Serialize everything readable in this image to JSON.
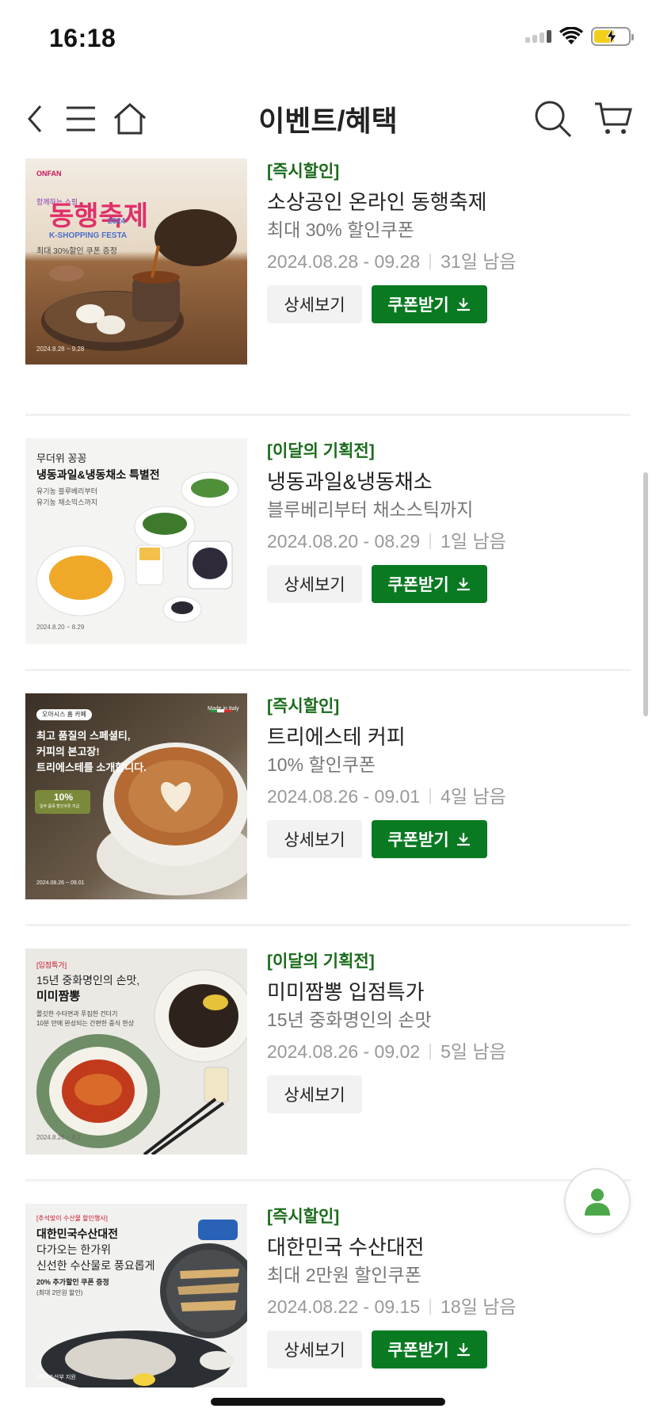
{
  "status_bar": {
    "time": "16:18"
  },
  "header": {
    "title": "이벤트/혜택"
  },
  "events": [
    {
      "category": "[즉시할인]",
      "title": "소상공인 온라인 동행축제",
      "subtitle": "최대 30% 할인쿠폰",
      "dates": "2024.08.28 - 09.28",
      "remaining": "31일 남음",
      "detail_label": "상세보기",
      "coupon_label": "쿠폰받기",
      "thumb": {
        "logo": "ONFAN",
        "line1": "함께하는 쇼핑",
        "headline": "동행축제",
        "year": "2024",
        "tagline": "K-SHOPPING FESTA",
        "offer": "최대 30%할인 쿠폰 증정",
        "date": "2024.8.28 ~ 9.28"
      }
    },
    {
      "category": "[이달의 기획전]",
      "title": "냉동과일&냉동채소",
      "subtitle": "블루베리부터 채소스틱까지",
      "dates": "2024.08.20 - 08.29",
      "remaining": "1일 남음",
      "detail_label": "상세보기",
      "coupon_label": "쿠폰받기",
      "thumb": {
        "line1": "무더위 꽁꽁",
        "headline": "냉동과일&냉동채소 특별전",
        "line3": "유기농 블루베리부터",
        "line4": "유기농 채소믹스까지",
        "date": "2024.8.20 ~ 8.29"
      }
    },
    {
      "category": "[즉시할인]",
      "title": "트리에스테 커피",
      "subtitle": "10% 할인쿠폰",
      "dates": "2024.08.26 - 09.01",
      "remaining": "4일 남음",
      "detail_label": "상세보기",
      "coupon_label": "쿠폰받기",
      "thumb": {
        "tag": "오아시스 홈 카페",
        "made": "Made in Italy",
        "line1": "최고 품질의 스페셜티,",
        "line2": "커피의 본고장!",
        "line3": "트리에스테를 소개합니다.",
        "badge": "10%",
        "badge_sub": "일부 품목 할인쿠폰 지급",
        "date": "2024.08.26 ~ 09.01"
      }
    },
    {
      "category": "[이달의 기획전]",
      "title": "미미짬뽕 입점특가",
      "subtitle": "15년 중화명인의 손맛",
      "dates": "2024.08.26 - 09.02",
      "remaining": "5일 남음",
      "detail_label": "상세보기",
      "coupon_label": "",
      "thumb": {
        "tag": "[입점특가]",
        "line1": "15년 중화명인의 손맛,",
        "headline": "미미짬뽕",
        "line3": "쫄깃한 수타면과 푸짐한 건더기",
        "line4": "10분 만에 완성되는 간편한 중식 한상",
        "date": "2024.8.26 ~ 9.2"
      }
    },
    {
      "category": "[즉시할인]",
      "title": "대한민국 수산대전",
      "subtitle": "최대 2만원 할인쿠폰",
      "dates": "2024.08.22 - 09.15",
      "remaining": "18일 남음",
      "detail_label": "상세보기",
      "coupon_label": "쿠폰받기",
      "thumb": {
        "tag": "[추석맞이 수산물 할인행사]",
        "headline": "대한민국수산대전",
        "line2": "다가오는 한가위",
        "line3": "신선한 수산물로 풍요롭게",
        "offer": "20% 추가할인 쿠폰 증정",
        "offer_sub": "(최대 2만원 할인)",
        "footer": "*해양수산부 지원"
      }
    }
  ],
  "colors": {
    "accent_green": "#0a7a22",
    "category_green": "#1b6b1b"
  },
  "icons": [
    "back-icon",
    "menu-icon",
    "home-icon",
    "search-icon",
    "cart-icon",
    "download-icon",
    "user-icon"
  ]
}
